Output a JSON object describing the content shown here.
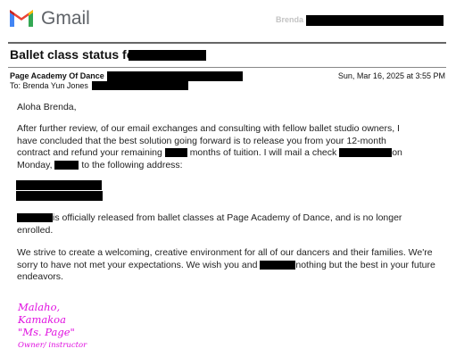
{
  "app": {
    "brand": "Gmail",
    "logo_icon": "gmail-m-icon",
    "brand_colors": {
      "blue": "#4285F4",
      "red": "#EA4335",
      "yellow": "#FBBC04",
      "green": "#34A853"
    },
    "account_name": "Brenda"
  },
  "email": {
    "subject": "Ballet class status for",
    "from_name": "Page Academy Of Dance",
    "to_label": "To: Brenda Yun Jones",
    "date": "Sun, Mar 16, 2025 at 3:55 PM",
    "greeting": "Aloha Brenda,",
    "p1_l1": "After further review, of our email exchanges and consulting with fellow ballet studio owners, I",
    "p1_l2": "have concluded that the best solution going forward is to release you from your 12-month",
    "p1_l3a": "contract and refund your remaining",
    "p1_l3b": "months of tuition. I will mail a check",
    "p1_l3c": "on",
    "p1_l4a": "Monday,",
    "p1_l4b": "to the following address:",
    "p2a": "is officially released from ballet classes at Page Academy of Dance, and is no longer enrolled.",
    "p3a": "We strive to create a welcoming, creative environment for all of our dancers and their families. We're sorry to have not met your expectations. We wish you and",
    "p3b": "nothing but the best in your future endeavors.",
    "signature": {
      "line1": "Malaho,",
      "line2": "Kamakoa",
      "line3": "\"Ms. Page\"",
      "line4": "Owner/ instructor",
      "color": "#E010E0"
    },
    "redaction_color": "#000000"
  }
}
